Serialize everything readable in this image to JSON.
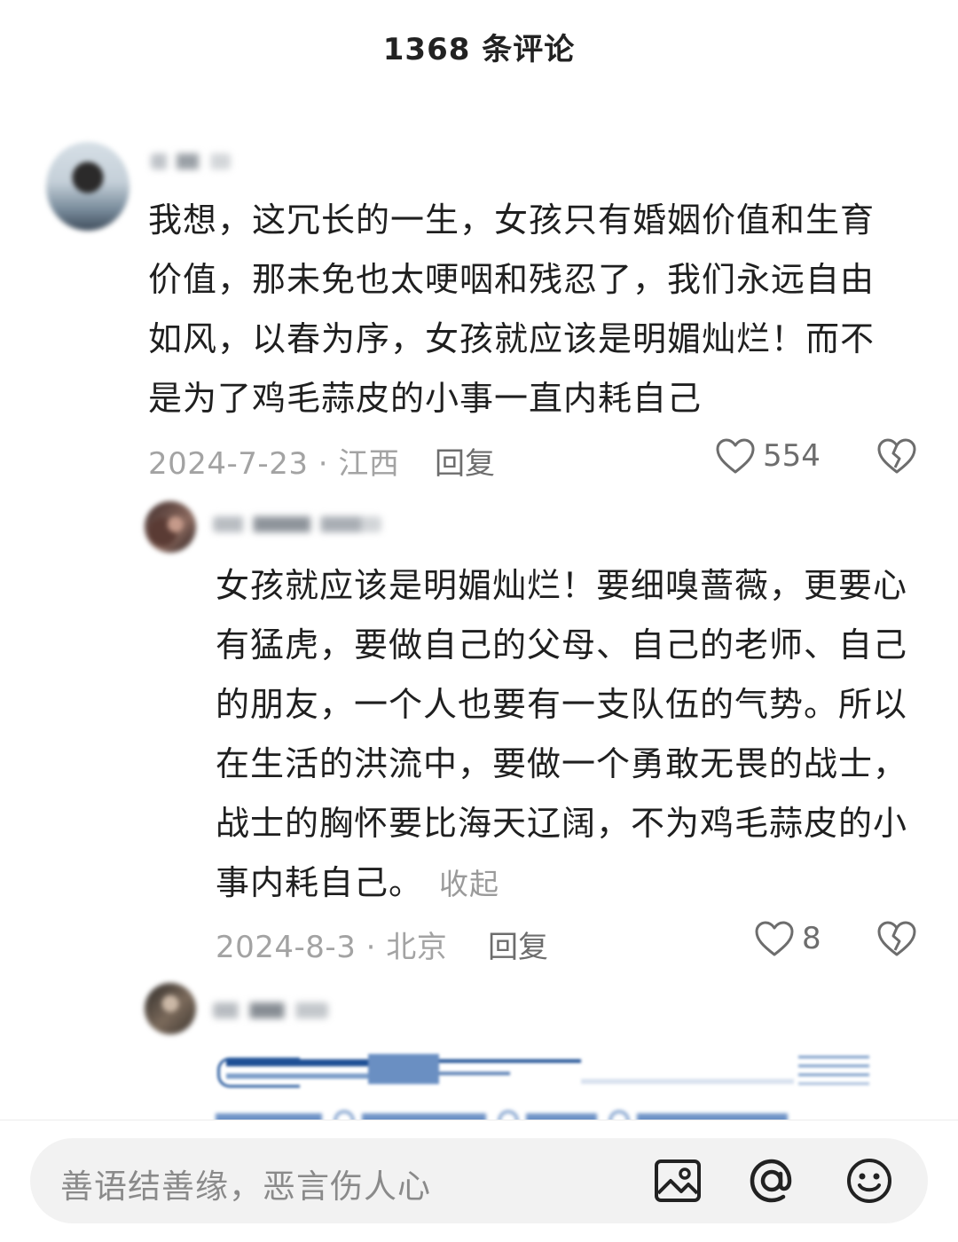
{
  "header": {
    "title": "1368 条评论"
  },
  "comments": [
    {
      "text": "我想，这冗长的一生，女孩只有婚姻价值和生育价值，那未免也太哽咽和残忍了，我们永远自由如风，以春为序，女孩就应该是明媚灿烂！而不是为了鸡毛蒜皮的小事一直内耗自己",
      "date": "2024-7-23",
      "location": "江西",
      "reply_label": "回复",
      "likes": "554"
    },
    {
      "text": "女孩就应该是明媚灿烂！要细嗅蔷薇，更要心有猛虎，要做自己的父母、自己的老师、自己的朋友，一个人也要有一支队伍的气势。所以在生活的洪流中，要做一个勇敢无畏的战士，战士的胸怀要比海天辽阔，不为鸡毛蒜皮的小事内耗自己。",
      "collapse_label": "收起",
      "date": "2024-8-3",
      "location": "北京",
      "reply_label": "回复",
      "likes": "8"
    }
  ],
  "input": {
    "placeholder": "善语结善缘，恶言伤人心"
  },
  "icons": {
    "like": "heart-outline-icon",
    "dislike": "broken-heart-icon",
    "image": "image-icon",
    "mention": "at-icon",
    "emoji": "emoji-icon"
  },
  "colors": {
    "text": "#1f1f1f",
    "meta": "#a3a3a3",
    "input_bg": "#f2f2f2"
  }
}
